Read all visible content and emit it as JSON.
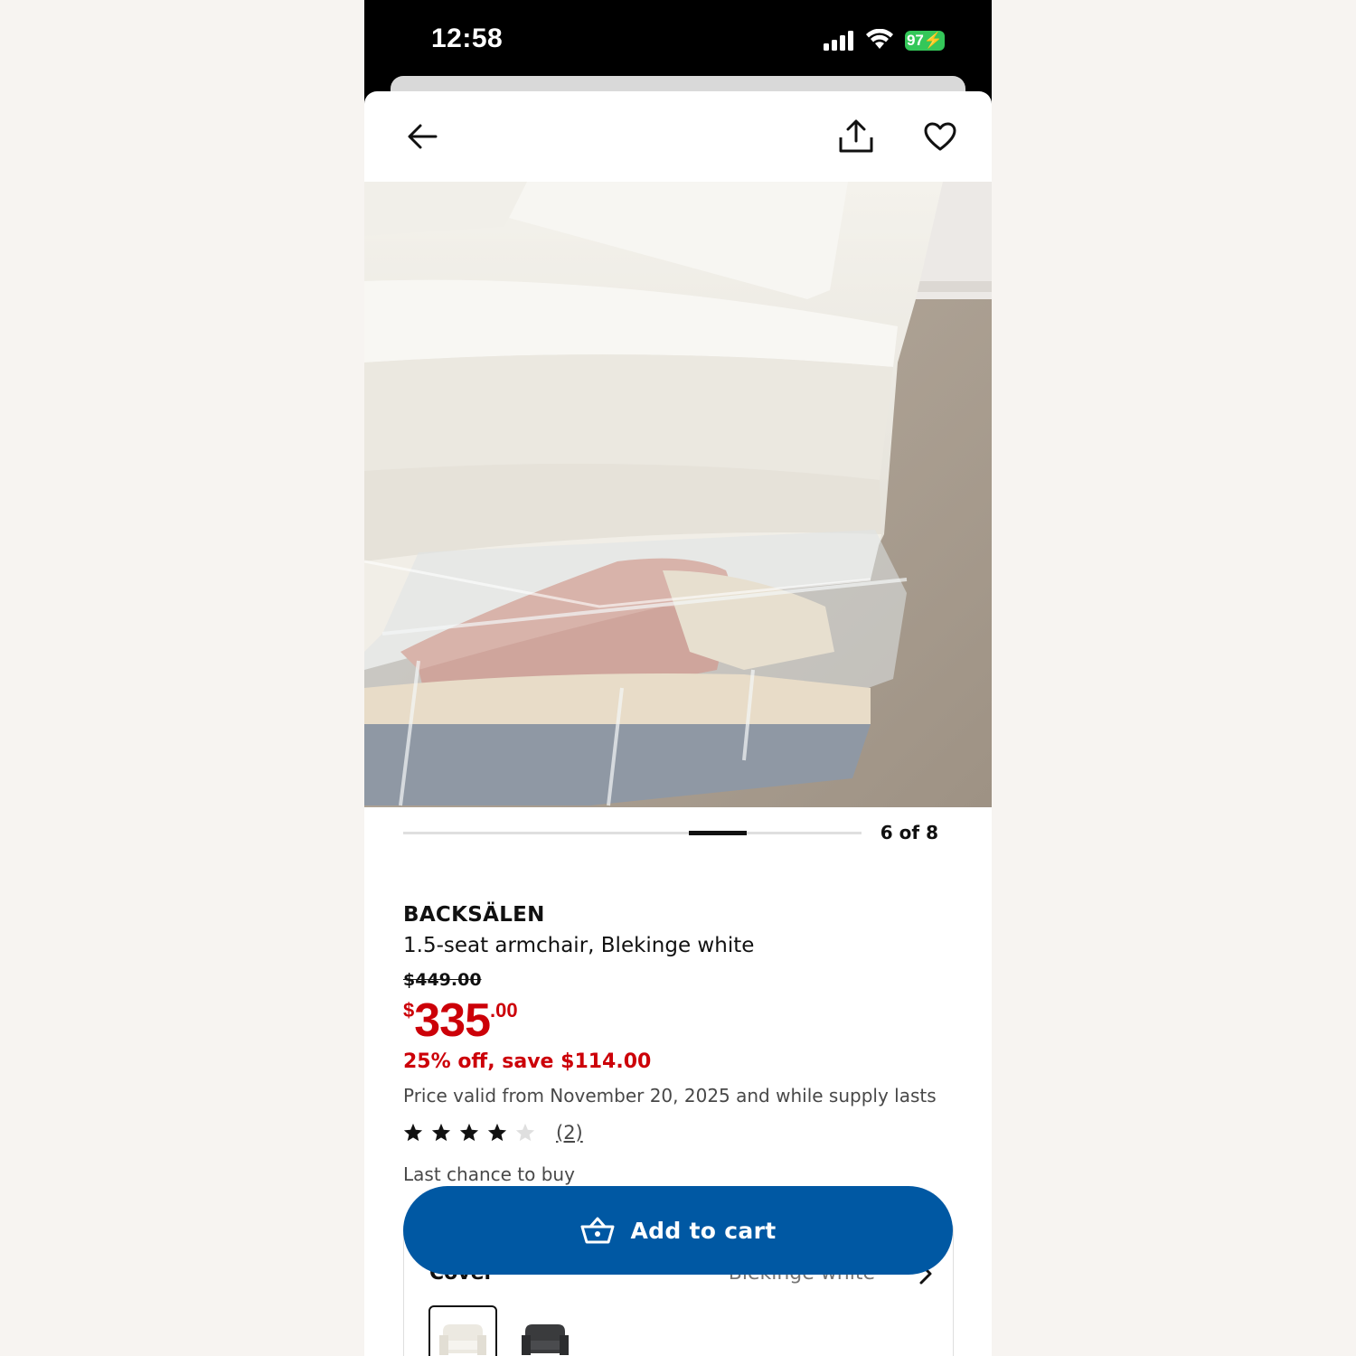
{
  "status_bar": {
    "time": "12:58",
    "battery": "97"
  },
  "gallery": {
    "position": "6 of 8",
    "current_index": 6,
    "total": 8
  },
  "product": {
    "name": "BACKSÄLEN",
    "description": "1.5-seat armchair, Blekinge white",
    "old_price": "$449.00",
    "price_currency": "$",
    "price_integer": "335",
    "price_decimal": ".00",
    "discount": "25% off, save $114.00",
    "validity": "Price valid from November 20, 2025 and while supply lasts",
    "rating": 4,
    "rating_max": 5,
    "review_count": "(2)",
    "availability": "Last chance to buy"
  },
  "cart": {
    "label": "Add to cart"
  },
  "options": {
    "cover_label": "Cover",
    "cover_value": "Blekinge white",
    "swatches": [
      "white-armchair",
      "black-armchair"
    ]
  },
  "colors": {
    "brand_blue": "#0058a3",
    "sale_red": "#cc0008",
    "battery_green": "#34c759"
  },
  "icons": [
    "back-arrow-icon",
    "share-icon",
    "heart-icon",
    "basket-icon",
    "chevron-right-icon",
    "star-icon"
  ]
}
